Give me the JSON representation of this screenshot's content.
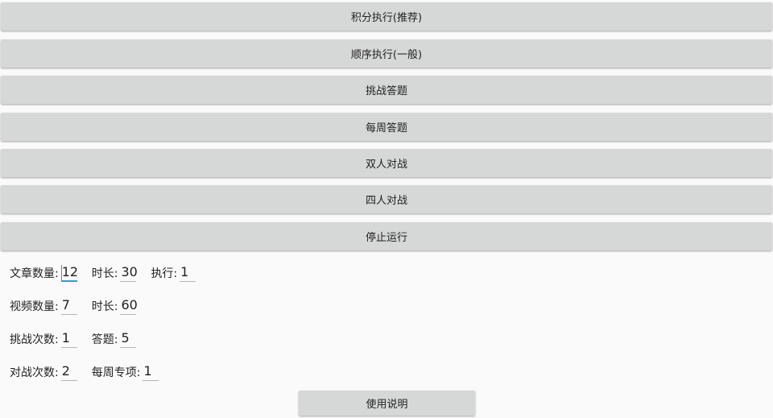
{
  "buttons": [
    {
      "id": "score-exec",
      "label": "积分执行(推荐)"
    },
    {
      "id": "sequential-exec",
      "label": "顺序执行(一般)"
    },
    {
      "id": "challenge-answer",
      "label": "挑战答题"
    },
    {
      "id": "weekly-answer",
      "label": "每周答题"
    },
    {
      "id": "two-person-battle",
      "label": "双人对战"
    },
    {
      "id": "four-person-battle",
      "label": "四人对战"
    },
    {
      "id": "stop-run",
      "label": "停止运行"
    }
  ],
  "settings": {
    "articles": {
      "count_label": "文章数量:",
      "count_value": "12",
      "duration_label": "时长:",
      "duration_value": "30",
      "exec_label": "执行:",
      "exec_value": "1"
    },
    "videos": {
      "count_label": "视频数量:",
      "count_value": "7",
      "duration_label": "时长:",
      "duration_value": "60"
    },
    "challenge": {
      "count_label": "挑战次数:",
      "count_value": "1",
      "answers_label": "答题:",
      "answers_value": "5"
    },
    "battle": {
      "count_label": "对战次数:",
      "count_value": "2",
      "weekly_label": "每周专项:",
      "weekly_value": "1"
    }
  },
  "help_button": {
    "label": "使用说明"
  },
  "colors": {
    "button_bg": "#d6d7d7",
    "accent": "#2a9ed8",
    "page_bg": "#fafafa"
  }
}
